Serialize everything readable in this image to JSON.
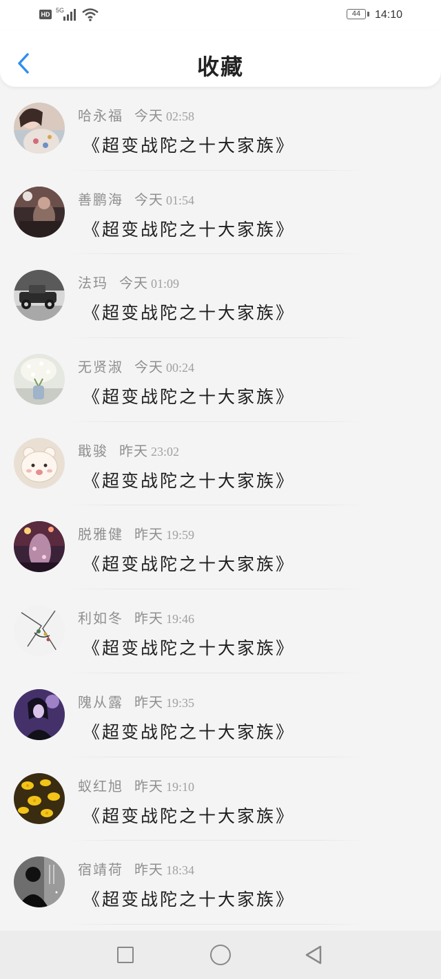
{
  "status_bar": {
    "network_badge": "HD",
    "network_type": "5G",
    "battery_level": "44",
    "time": "14:10"
  },
  "header": {
    "title": "收藏",
    "back_icon": "chevron-left-icon"
  },
  "colors": {
    "accent": "#2e8ff0",
    "name_text": "#8f8f8f",
    "title_text": "#1e1e1e"
  },
  "favorites": [
    {
      "name": "哈永福",
      "day": "今天",
      "time": "02:58",
      "title": "《超变战陀之十大家族》",
      "avatar": "girl-in-floral-dress"
    },
    {
      "name": "善鹏海",
      "day": "今天",
      "time": "01:54",
      "title": "《超变战陀之十大家族》",
      "avatar": "person-dark-room"
    },
    {
      "name": "法玛",
      "day": "今天",
      "time": "01:09",
      "title": "《超变战陀之十大家族》",
      "avatar": "vintage-car"
    },
    {
      "name": "无贤淑",
      "day": "今天",
      "time": "00:24",
      "title": "《超变战陀之十大家族》",
      "avatar": "white-flowers-vase"
    },
    {
      "name": "戢骏",
      "day": "昨天",
      "time": "23:02",
      "title": "《超变战陀之十大家族》",
      "avatar": "cartoon-bear"
    },
    {
      "name": "脱雅健",
      "day": "昨天",
      "time": "19:59",
      "title": "《超变战陀之十大家族》",
      "avatar": "night-lights"
    },
    {
      "name": "利如冬",
      "day": "昨天",
      "time": "19:46",
      "title": "《超变战陀之十大家族》",
      "avatar": "manga-sketch"
    },
    {
      "name": "隗从露",
      "day": "昨天",
      "time": "19:35",
      "title": "《超变战陀之十大家族》",
      "avatar": "girl-purple-light"
    },
    {
      "name": "蚁红旭",
      "day": "昨天",
      "time": "19:10",
      "title": "《超变战陀之十大家族》",
      "avatar": "yellow-flowers"
    },
    {
      "name": "宿靖荷",
      "day": "昨天",
      "time": "18:34",
      "title": "《超变战陀之十大家族》",
      "avatar": "dark-silhouette"
    }
  ],
  "nav_bar": {
    "recents_icon": "square-icon",
    "home_icon": "circle-icon",
    "back_icon": "triangle-back-icon"
  }
}
